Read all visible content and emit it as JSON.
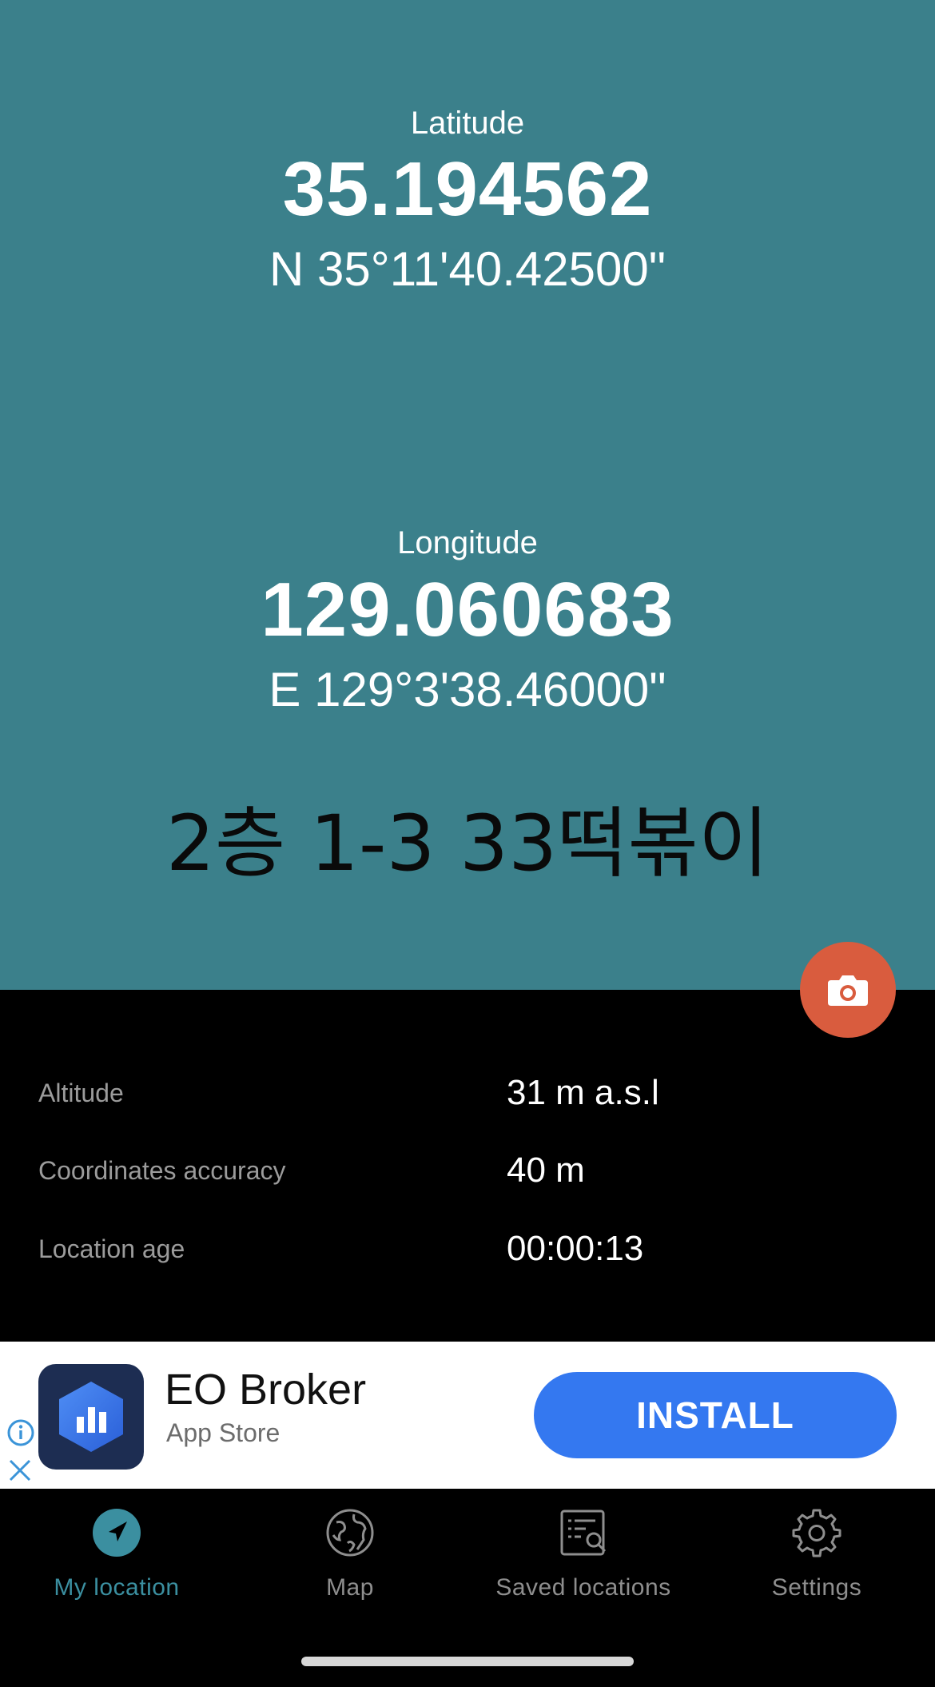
{
  "colors": {
    "primary_teal": "#3b808b",
    "camera_button": "#d95c3e",
    "install_button": "#3478f0",
    "active_tab": "#3b8fa0"
  },
  "location": {
    "latitude_label": "Latitude",
    "latitude_decimal": "35.194562",
    "latitude_dms": "N 35°11'40.42500\"",
    "longitude_label": "Longitude",
    "longitude_decimal": "129.060683",
    "longitude_dms": "E 129°3'38.46000\"",
    "address": "2층 1-3 33떡볶이"
  },
  "camera_button": {
    "icon": "camera-icon"
  },
  "details": [
    {
      "label": "Altitude",
      "value": "31 m a.s.l"
    },
    {
      "label": "Coordinates accuracy",
      "value": "40 m"
    },
    {
      "label": "Location age",
      "value": "00:00:13"
    }
  ],
  "ad": {
    "app_name": "EO Broker",
    "store": "App Store",
    "install_label": "INSTALL",
    "icon": "bar-chart-hexagon-icon"
  },
  "tabs": [
    {
      "label": "My location",
      "icon": "navigation-arrow-icon",
      "active": true
    },
    {
      "label": "Map",
      "icon": "globe-icon",
      "active": false
    },
    {
      "label": "Saved locations",
      "icon": "saved-list-search-icon",
      "active": false
    },
    {
      "label": "Settings",
      "icon": "gear-icon",
      "active": false
    }
  ]
}
